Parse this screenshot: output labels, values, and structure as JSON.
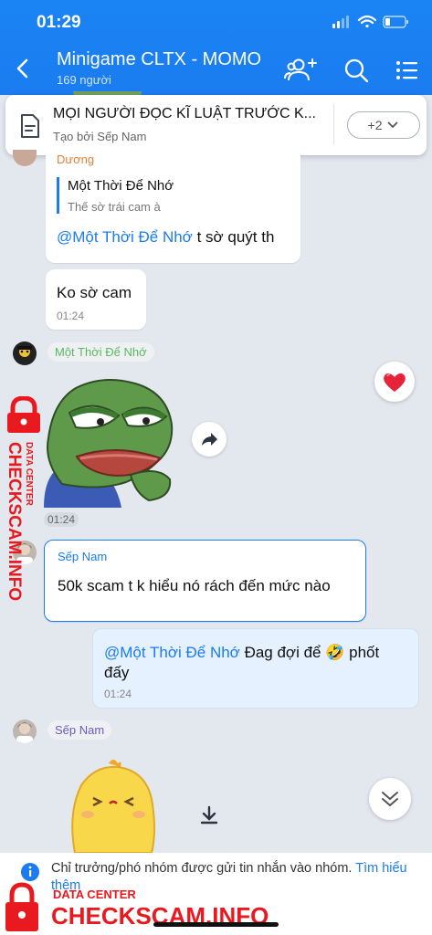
{
  "status": {
    "time": "01:29"
  },
  "header": {
    "title": "Minigame CLTX - MOMO",
    "members": "169 người"
  },
  "pinned": {
    "title": "MỌI NGƯỜI ĐỌC KĨ LUẬT TRƯỚC K...",
    "subtitle": "Tạo bởi Sếp Nam",
    "more": "+2"
  },
  "messages": {
    "m1": {
      "sender_fragment": "Dương",
      "quote_author": "Một Thời Để Nhớ",
      "quote_text": "Thế sờ trái cam à",
      "mention": "@Một Thời Để Nhớ",
      "text": " t sờ quýt th"
    },
    "m2": {
      "text": "Ko sờ cam",
      "time": "01:24"
    },
    "m3": {
      "sender": "Một Thời Để Nhớ",
      "time": "01:24",
      "reaction": "❤️"
    },
    "m4": {
      "sender": "Sếp Nam",
      "text": "50k scam t k hiểu nó rách đến mức nào"
    },
    "m5": {
      "mention": "@Một Thời Để Nhớ",
      "text_a": " Đag đợi để ",
      "emoji": "🤣",
      "text_b": " phốt",
      "text_c": "đấy",
      "time": "01:24"
    },
    "m6": {
      "sender": "Sếp Nam"
    }
  },
  "footer": {
    "text": "Chỉ trưởng/phó nhóm được gửi tin nhắn vào nhóm. ",
    "link": "Tìm hiểu thêm"
  },
  "watermark": {
    "side_top": "DATA CENTER",
    "side_main": "CHECKSCAM.INFO",
    "bottom_top": "DATA CENTER",
    "bottom_main": "CHECKSCAM.INFO"
  },
  "colors": {
    "header": "#1a7cf0",
    "mention": "#1a7cf0",
    "sent_bubble": "#e5f1ff",
    "watermark": "#e8191f"
  }
}
